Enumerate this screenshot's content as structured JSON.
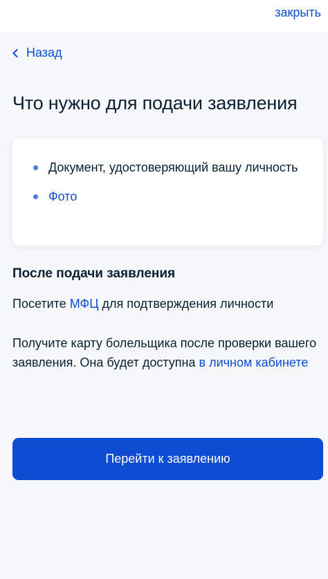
{
  "header": {
    "close_label": "закрыть"
  },
  "nav": {
    "back_label": "Назад",
    "back_icon": "chevron-left-icon"
  },
  "main": {
    "title": "Что нужно для подачи заявления",
    "requirements": [
      {
        "label": "Документ, удостоверяющий вашу личность",
        "is_link": false
      },
      {
        "label": "Фото",
        "is_link": true
      }
    ],
    "after_section": {
      "title": "После подачи заявления",
      "visit_prefix": "Посетите ",
      "visit_link": "МФЦ",
      "visit_suffix": " для подтверждения личности",
      "card_text": "Получите карту болельщика после проверки вашего заявления. Она будет доступна ",
      "card_link": "в личном кабинете"
    },
    "primary_button_label": "Перейти к заявлению"
  },
  "colors": {
    "accent": "#0d4cd3",
    "bullet": "#4f7de6",
    "background": "#f5f7fa",
    "text": "#0b1f33"
  }
}
